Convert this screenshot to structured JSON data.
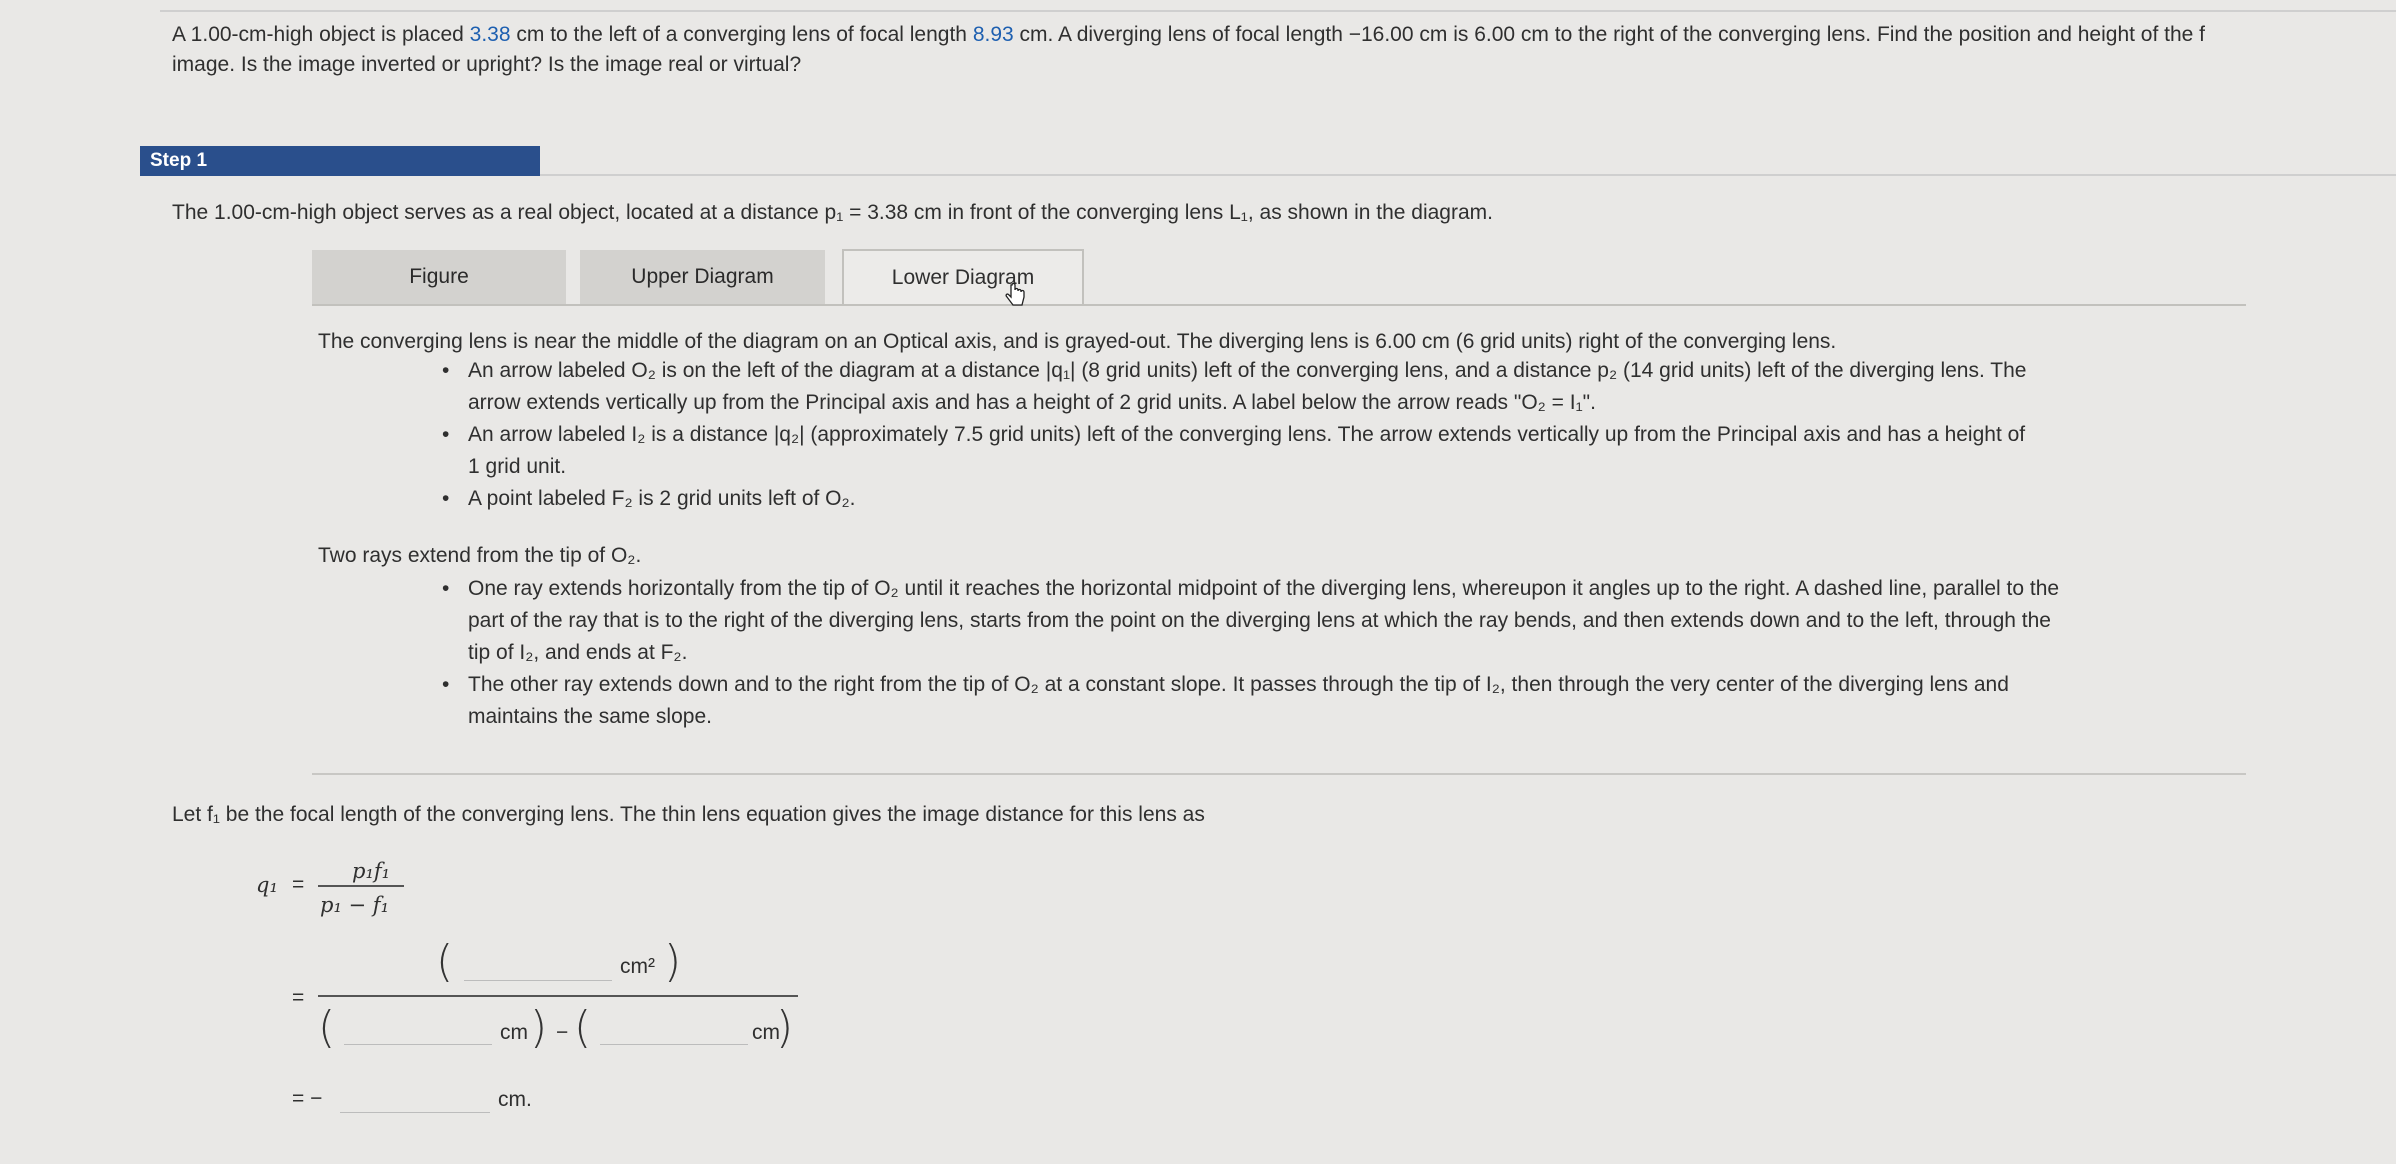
{
  "question": {
    "line1": [
      {
        "t": "A 1.00-cm-high object is placed "
      },
      {
        "t": "3.38",
        "hl": true
      },
      {
        "t": " cm to the left of a converging lens of focal length "
      },
      {
        "t": "8.93",
        "hl": true
      },
      {
        "t": " cm. A diverging lens of focal length −16.00 cm is 6.00 cm to the right of the converging lens. Find the position and height of the f"
      }
    ],
    "line2": "image. Is the image inverted or upright? Is the image real or virtual?"
  },
  "step": {
    "label": "Step 1"
  },
  "intro": "The 1.00-cm-high object serves as a real object, located at a distance p₁ = 3.38 cm in front of the converging lens L₁, as shown in the diagram.",
  "tabs": [
    {
      "label": "Figure",
      "active": false
    },
    {
      "label": "Upper Diagram",
      "active": false
    },
    {
      "label": "Lower Diagram",
      "active": true
    }
  ],
  "diagram_desc": {
    "para1": "The converging lens is near the middle of the diagram on an Optical axis, and is grayed-out. The diverging lens is 6.00 cm (6 grid units) right of the converging lens.",
    "bullets1": [
      [
        "An arrow labeled O₂ is on the left of the diagram at a distance |q₁| (8 grid units) left of the converging lens, and a distance p₂ (14 grid units) left of the diverging lens. The",
        "arrow extends vertically up from the Principal axis and has a height of 2 grid units. A label below the arrow reads \"O₂ = I₁\"."
      ],
      [
        "An arrow labeled I₂ is a distance |q₂| (approximately 7.5 grid units) left of the converging lens. The arrow extends vertically up from the Principal axis and has a height of",
        "1 grid unit."
      ],
      [
        "A point labeled F₂ is 2 grid units left of O₂."
      ]
    ],
    "para2": "Two rays extend from the tip of O₂.",
    "bullets2": [
      [
        "One ray extends horizontally from the tip of O₂ until it reaches the horizontal midpoint of the diverging lens, whereupon it angles up to the right. A dashed line, parallel to the",
        "part of the ray that is to the right of the diverging lens, starts from the point on the diverging lens at which the ray bends, and then extends down and to the left, through the",
        "tip of I₂, and ends at F₂."
      ],
      [
        "The other ray extends down and to the right from the tip of O₂ at a constant slope. It passes through the tip of I₂, then through the very center of the diverging lens and",
        "maintains the same slope."
      ]
    ]
  },
  "lens_eq": {
    "intro": "Let f₁ be the focal length of the converging lens. The thin lens equation gives the image distance for this lens as",
    "lhs": "q₁",
    "equals": "=",
    "numerator": "p₁f₁",
    "denominator": "p₁ − f₁",
    "unit_cm2": "cm²",
    "unit_cm": "cm",
    "minus": "−",
    "result_prefix": "= −",
    "result_unit": "cm."
  }
}
